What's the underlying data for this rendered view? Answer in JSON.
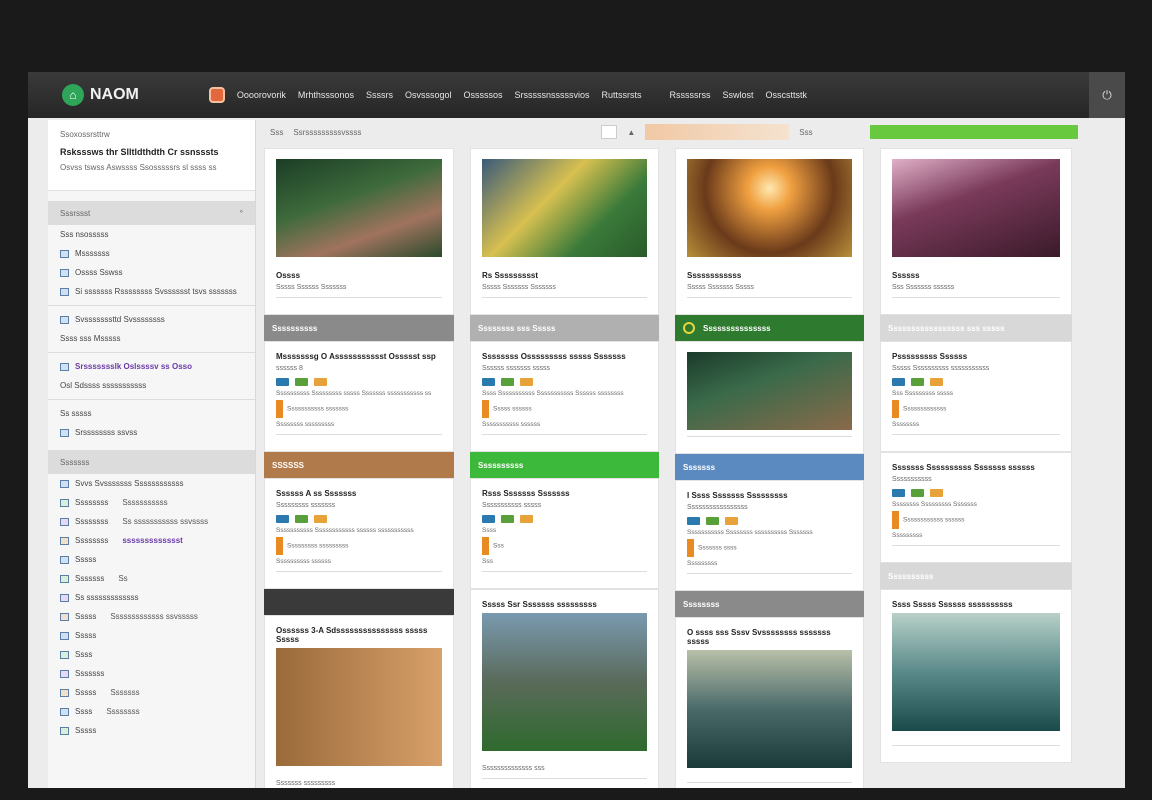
{
  "app": {
    "logo_text": "NAOM",
    "nav": [
      "Oooorovorik",
      "Mrhthsssonos",
      "Ssssrs",
      "Osvsssogol",
      "Osssssos",
      "Srsssssnsssssvios",
      "Ruttssrsts",
      "Rsssssrss",
      "Sswlost",
      "Osscsttstk"
    ]
  },
  "sidebar": {
    "card": {
      "small": "Ssoxossrsttrw",
      "title": "Rsksssws thr Slltldthdth Cr ssnsssts",
      "sub": "Osvss tswss Aswssss Ssosssssrs sl ssss ss"
    },
    "section1": {
      "title": "Sssrssst",
      "sub": "Sss nsosssss"
    },
    "items1": [
      {
        "label": "Msssssss"
      },
      {
        "label": "Ossss Sswss"
      },
      {
        "label": "Si sssssss Rssssssss Svsssssst tsvs sssssss"
      }
    ],
    "items2": [
      {
        "label": "Svsssssssttd Svssssssss"
      },
      {
        "label": "Ssss sss  Msssss"
      }
    ],
    "items3": [
      {
        "label": "Srssssssslk Oslssssv ss Osso"
      },
      {
        "label": "Osl Sdssss sssssssssss"
      }
    ],
    "items4": [
      {
        "label": "Ss sssss"
      },
      {
        "label": "Srssssssss ssvss"
      }
    ],
    "section2": {
      "title": "Sssssss"
    },
    "list": [
      {
        "label": "Svvs  Svsssssss  Ssssssssssss",
        "value": ""
      },
      {
        "label": "Ssssssss",
        "value": "Sssssssssss"
      },
      {
        "label": "Ssssssss",
        "value": "Ss sssssssssss ssvssss"
      },
      {
        "label": "Ssssssss",
        "value": "ssssssssssssst"
      },
      {
        "label": "Sssss",
        "value": ""
      },
      {
        "label": "Sssssss",
        "value": "Ss"
      },
      {
        "label": "Ss sssssssssssss",
        "value": ""
      },
      {
        "label": "Sssss",
        "value": "Sssssssssssss ssvsssss"
      },
      {
        "label": "Sssss",
        "value": ""
      },
      {
        "label": "Ssss",
        "value": ""
      },
      {
        "label": "Sssssss",
        "value": ""
      },
      {
        "label": "Sssss",
        "value": "Sssssss"
      },
      {
        "label": "Ssss",
        "value": "Ssssssss"
      },
      {
        "label": "Sssss",
        "value": ""
      }
    ]
  },
  "toolbar": {
    "label1": "Sss",
    "label2": "Ssrsssssssssvssss",
    "label3": "Sss"
  },
  "columns": [
    {
      "cards": [
        {
          "title": "Ossss",
          "sub": "Sssss Ssssss Sssssss"
        },
        {
          "banner": "Ssssssssss",
          "title": "Msssssssg O Assssssssssst Ossssst ssp",
          "sub": "ssssss 8",
          "lines": [
            "Ssssssssss Sssssssss sssss Sssssss sssssssssss ss",
            "Sssssssssss sssssss",
            "Ssssssss sssssssss"
          ]
        },
        {
          "banner": "SSSSSS",
          "title": "Ssssss A ss Sssssss",
          "sub": "Sssssssss sssssss",
          "lines": [
            "Sssssssssss Ssssssssssss ssssss sssssssssss",
            "Sssssssss sssssssss",
            "Ssssssssss ssssss"
          ]
        },
        {
          "banner": "",
          "title": "Ossssss 3-A Sdsssssssssssssss sssss Sssss",
          "sub": "Sssssss sssssssss"
        }
      ]
    },
    {
      "cards": [
        {
          "title": "Rs Ssssssssst",
          "sub": "Sssss Sssssss Sssssss"
        },
        {
          "banner": "Ssssssss sss Sssss",
          "title": "Ssssssss Osssssssss sssss Sssssss",
          "sub": "Ssssss sssssss sssss",
          "lines": [
            "Ssss Sssssssssss Sssssssssss Ssssss ssssssss",
            "Sssss ssssss",
            "Sssssssssss ssssss"
          ]
        },
        {
          "banner": "Ssssssssss",
          "title": "Rsss Sssssss Sssssss",
          "sub": "Sssssssssss sssss",
          "lines": [
            "Ssss",
            "Sss",
            "Sss"
          ]
        },
        {
          "title": "Sssss Ssr Sssssss sssssssss",
          "sub": "Ssssssssssssss sss"
        }
      ]
    },
    {
      "cards": [
        {
          "title": "Ssssssssssss",
          "sub": "Sssss Sssssss Sssss"
        },
        {
          "banner": "Sssssssssssssss",
          "title": "",
          "sub": ""
        },
        {
          "banner": "Sssssss",
          "title": "I Ssss Sssssss Sssssssss",
          "sub": "Sssssssssssssssss",
          "lines": [
            "Sssssssssss Ssssssss ssssssssss Sssssss",
            "Sssssss ssss",
            "Sssssssss"
          ]
        },
        {
          "banner": "Ssssssss",
          "title": "O ssss sss Sssv Svssssssss sssssss sssss",
          "sub": ""
        }
      ]
    },
    {
      "cards": [
        {
          "title": "Ssssss",
          "sub": "Sss Sssssss ssssss"
        },
        {
          "banner": "Sssssssssssssssss sss sssss",
          "title": "Psssssssss Ssssss",
          "sub": "Sssss Ssssssssss sssssssssss",
          "lines": [
            "Sss Sssssssss sssss",
            "Sssssssssssss",
            "Ssssssss"
          ]
        },
        {
          "title": "Sssssss Ssssssssss Sssssss ssssss",
          "sub": "Sssssssssss",
          "lines": [
            "Ssssssss Sssssssss Sssssss",
            "Ssssssssssss ssssss",
            "Sssssssss"
          ]
        },
        {
          "banner": "Ssssssssss",
          "title": "Ssss Sssss Ssssss ssssssssss",
          "sub": ""
        }
      ]
    }
  ]
}
